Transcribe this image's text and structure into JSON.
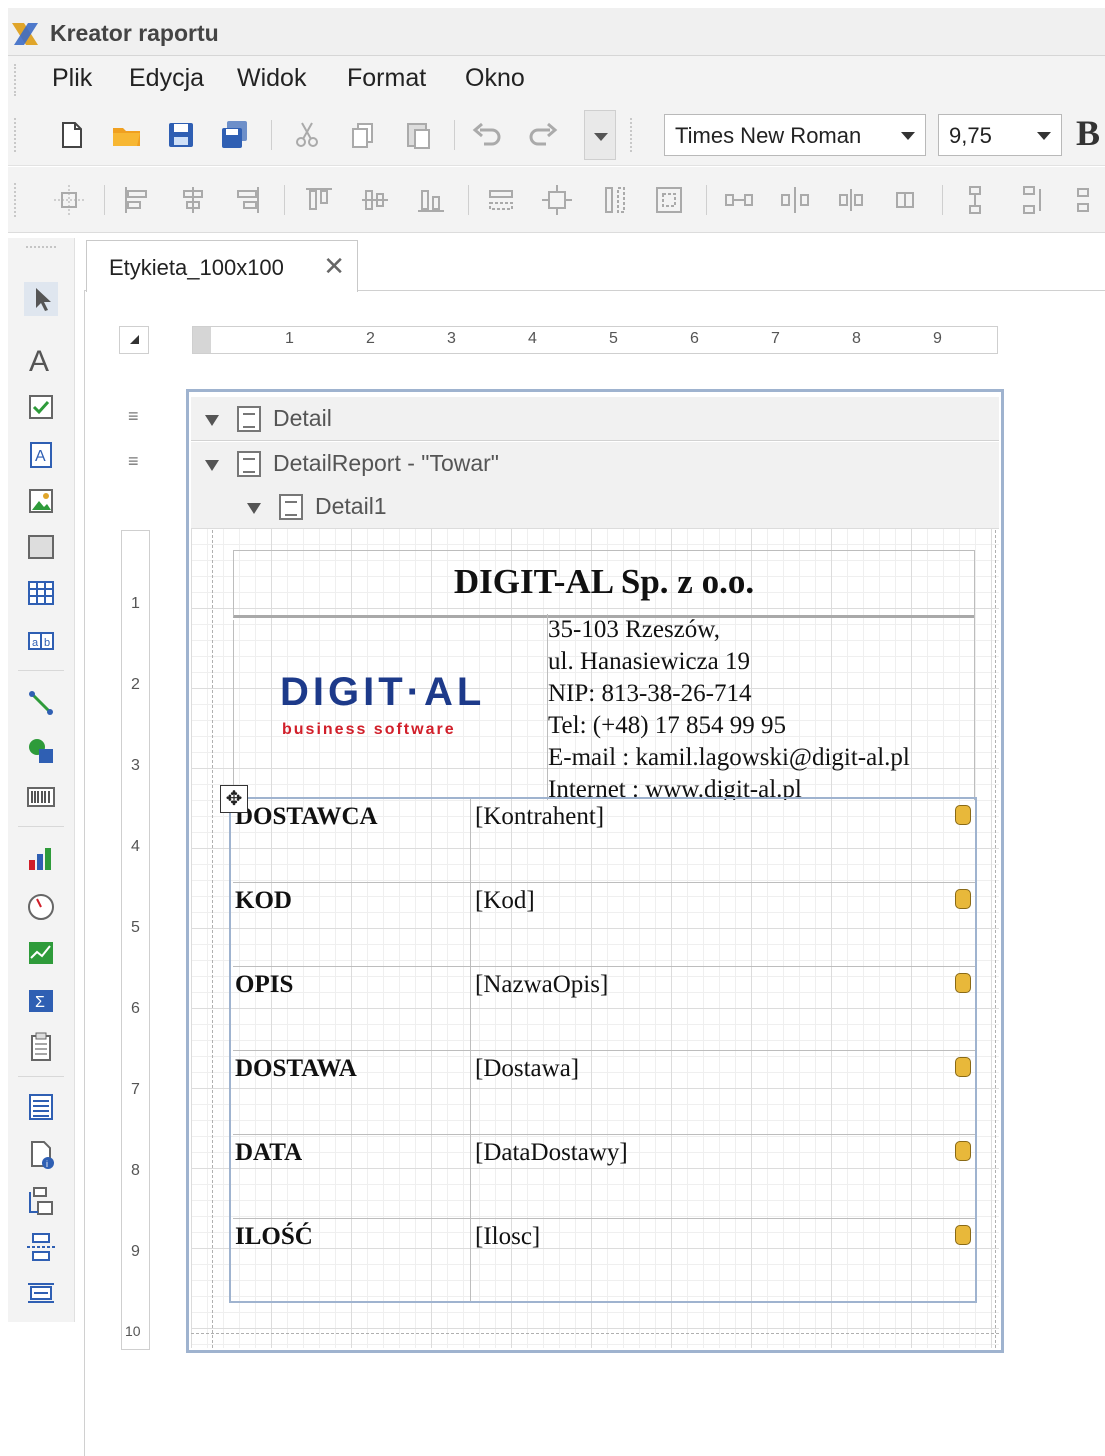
{
  "window": {
    "title": "Kreator raportu",
    "app_icon": "report-designer-icon"
  },
  "menu": {
    "items": [
      "Plik",
      "Edycja",
      "Widok",
      "Format",
      "Okno"
    ]
  },
  "toolbar": {
    "font_name": "Times New Roman",
    "font_size": "9,75",
    "bold_label": "B",
    "icons": [
      "new-document-icon",
      "open-folder-icon",
      "save-icon",
      "save-all-icon",
      "cut-icon",
      "copy-icon",
      "paste-icon",
      "undo-icon",
      "redo-icon",
      "toolbar-dropdown-icon"
    ]
  },
  "layout_toolbar": {
    "icons": [
      "align-to-grid-icon",
      "align-lefts-icon",
      "align-centers-icon",
      "align-rights-icon",
      "align-tops-icon",
      "align-middles-icon",
      "align-bottoms-icon",
      "make-same-width-icon",
      "size-to-grid-icon",
      "make-same-height-icon",
      "make-same-size-icon",
      "horizontal-spacing-equal-icon",
      "increase-horizontal-spacing-icon",
      "decrease-horizontal-spacing-icon",
      "remove-horizontal-spacing-icon",
      "vertical-spacing-equal-icon",
      "increase-vertical-spacing-icon",
      "decrease-vertical-spacing-icon"
    ]
  },
  "tab": {
    "label": "Etykieta_100x100",
    "close_glyph": "✕"
  },
  "ruler": {
    "marks": [
      "1",
      "2",
      "3",
      "4",
      "5",
      "6",
      "7",
      "8",
      "9"
    ],
    "vmarks": [
      "1",
      "2",
      "3",
      "4",
      "5",
      "6",
      "7",
      "8",
      "9",
      "10"
    ]
  },
  "bands": {
    "detail": "Detail",
    "detail_report": "DetailReport - \"Towar\"",
    "detail1": "Detail1"
  },
  "label": {
    "company": "DIGIT-AL Sp. z o.o.",
    "logo_main": "DIGIT·AL",
    "logo_sub": "business software",
    "address": [
      "35-103 Rzeszów,",
      "ul. Hanasiewicza 19",
      "NIP: 813-38-26-714",
      "Tel: (+48) 17 854 99 95",
      "E-mail : kamil.lagowski@digit-al.pl",
      "Internet : www.digit-al.pl"
    ],
    "rows": [
      {
        "key": "DOSTAWCA",
        "value": "[Kontrahent]"
      },
      {
        "key": "KOD",
        "value": "[Kod]"
      },
      {
        "key": "OPIS",
        "value": "[NazwaOpis]"
      },
      {
        "key": "DOSTAWA",
        "value": "[Dostawa]"
      },
      {
        "key": "DATA",
        "value": "[DataDostawy]"
      },
      {
        "key": "ILOŚĆ",
        "value": "[Ilosc]"
      }
    ]
  },
  "colors": {
    "accent": "#1d3a8a",
    "logo_red": "#d11f2a",
    "page_border": "#9fb3cf",
    "toolbar_bg": "#f3f3f3"
  }
}
